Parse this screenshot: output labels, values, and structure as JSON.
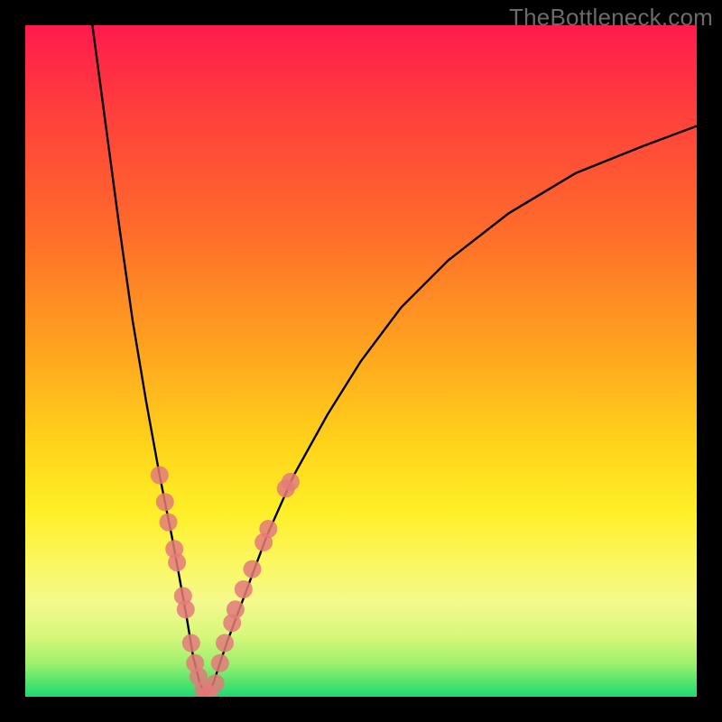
{
  "watermark": "TheBottleneck.com",
  "chart_data": {
    "type": "line",
    "title": "",
    "xlabel": "",
    "ylabel": "",
    "xlim": [
      0,
      100
    ],
    "ylim": [
      0,
      100
    ],
    "series": [
      {
        "name": "bottleneck-curve",
        "x": [
          10,
          12,
          14,
          16,
          18,
          20,
          22,
          24,
          25,
          26,
          27,
          28,
          30,
          33,
          36,
          40,
          45,
          50,
          56,
          63,
          72,
          82,
          92,
          100
        ],
        "y": [
          100,
          85,
          70,
          56,
          44,
          33,
          23,
          12,
          6,
          2,
          0,
          2,
          8,
          16,
          24,
          33,
          42,
          50,
          58,
          65,
          72,
          78,
          82,
          85
        ]
      }
    ],
    "markers": {
      "name": "highlight-dots",
      "color": "#e37a7a",
      "points": [
        {
          "x": 20.0,
          "y": 33
        },
        {
          "x": 20.8,
          "y": 29
        },
        {
          "x": 21.3,
          "y": 26
        },
        {
          "x": 22.2,
          "y": 22
        },
        {
          "x": 22.6,
          "y": 20
        },
        {
          "x": 23.5,
          "y": 15
        },
        {
          "x": 23.9,
          "y": 13
        },
        {
          "x": 24.7,
          "y": 8
        },
        {
          "x": 25.3,
          "y": 5
        },
        {
          "x": 25.8,
          "y": 3
        },
        {
          "x": 26.5,
          "y": 1
        },
        {
          "x": 27.3,
          "y": 0.5
        },
        {
          "x": 28.3,
          "y": 2
        },
        {
          "x": 29.0,
          "y": 5
        },
        {
          "x": 29.7,
          "y": 8
        },
        {
          "x": 30.8,
          "y": 11
        },
        {
          "x": 31.3,
          "y": 13
        },
        {
          "x": 32.5,
          "y": 16
        },
        {
          "x": 33.8,
          "y": 19
        },
        {
          "x": 35.5,
          "y": 23
        },
        {
          "x": 36.2,
          "y": 25
        },
        {
          "x": 38.8,
          "y": 31
        },
        {
          "x": 39.5,
          "y": 32
        }
      ]
    }
  }
}
